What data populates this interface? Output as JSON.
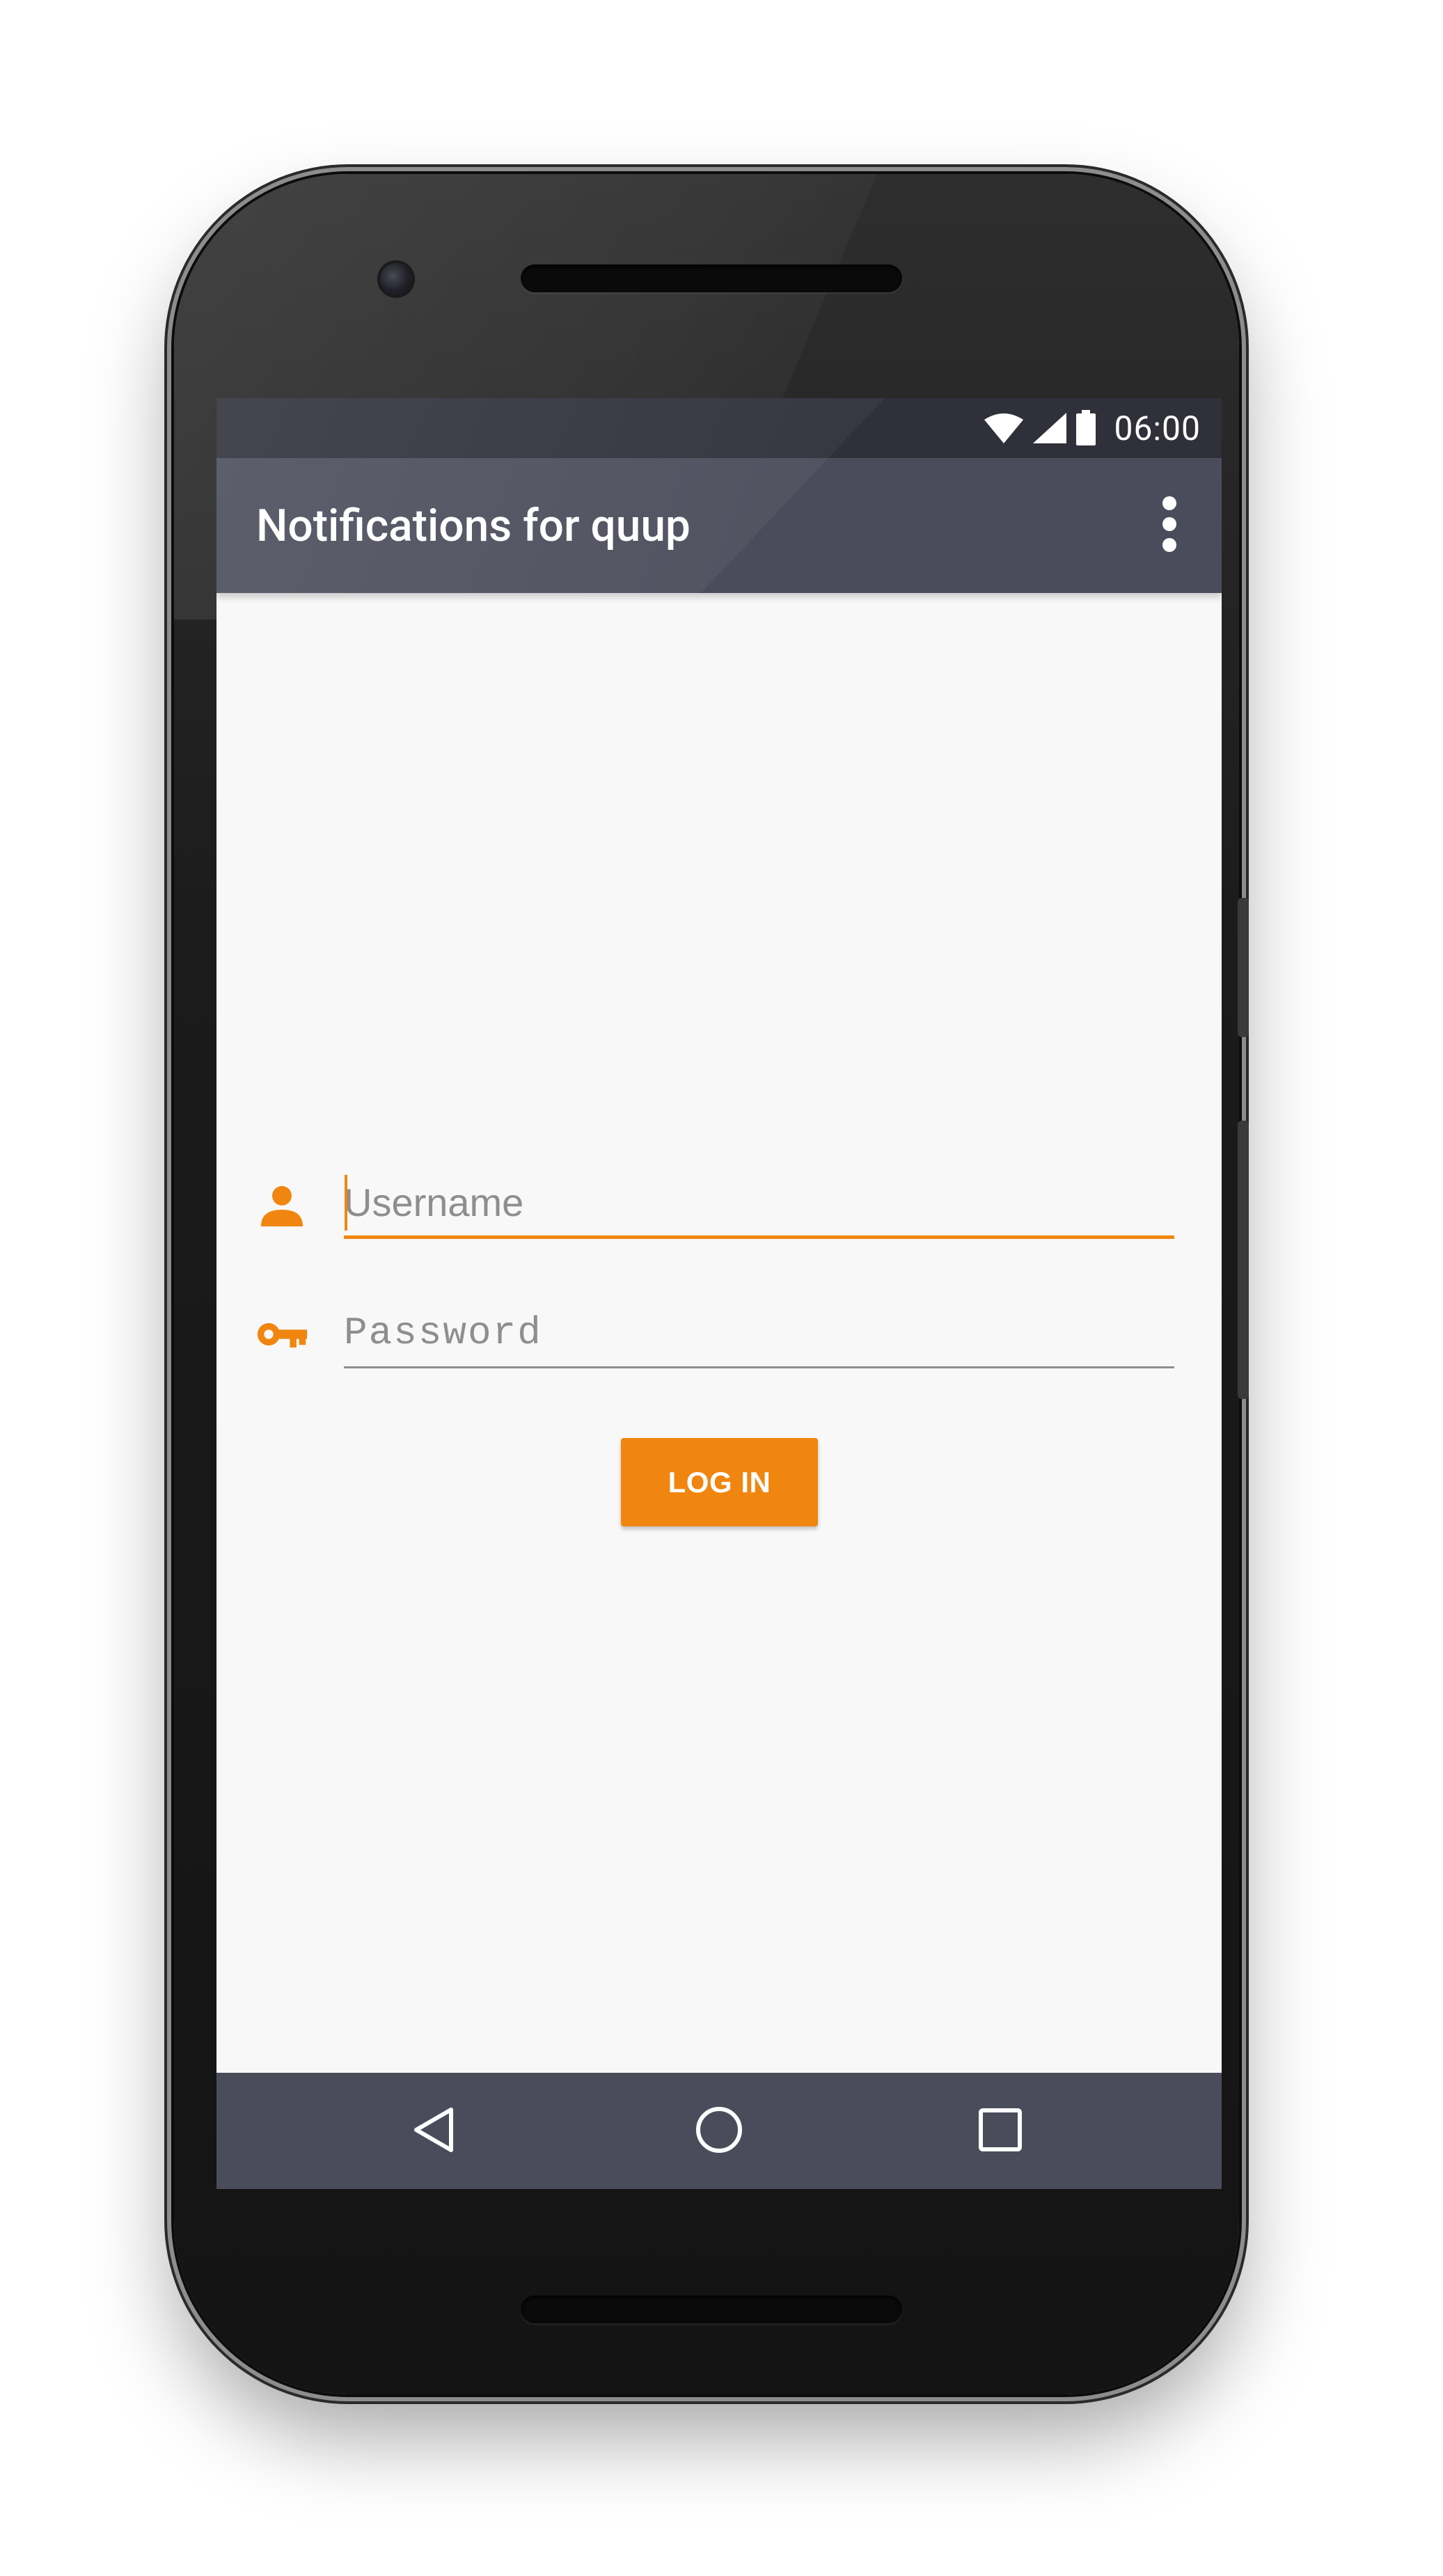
{
  "status_bar": {
    "time": "06:00",
    "icons": [
      "wifi-icon",
      "cellular-signal-icon",
      "battery-icon"
    ]
  },
  "app_bar": {
    "title": "Notifications for quup",
    "overflow_icon": "more-vert-icon"
  },
  "login_form": {
    "username": {
      "icon": "person-icon",
      "placeholder": "Username",
      "value": ""
    },
    "password": {
      "icon": "key-icon",
      "placeholder": "Password",
      "value": ""
    },
    "login_button_label": "LOG IN"
  },
  "nav_bar": {
    "buttons": [
      "back-icon",
      "home-icon",
      "recents-icon"
    ]
  },
  "colors": {
    "accent": "#f0860f",
    "app_bar": "#4b4c5b",
    "status_bar": "#2f303a",
    "background": "#f8f8f8"
  }
}
